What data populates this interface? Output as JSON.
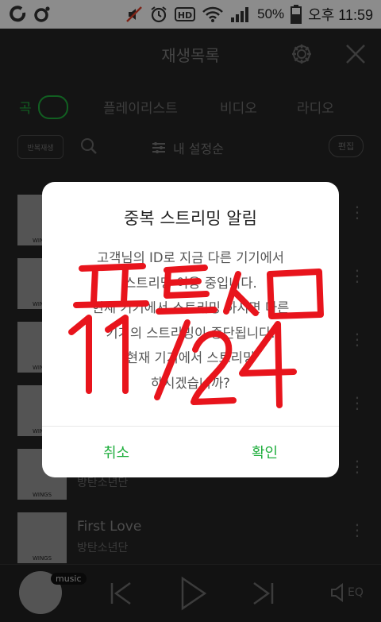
{
  "status_bar": {
    "battery": "50%",
    "time": "오후 11:59",
    "icons": [
      "o-icon",
      "record-icon",
      "mute-icon",
      "alarm-icon",
      "hd-icon",
      "wifi-icon",
      "signal-icon",
      "battery-icon"
    ]
  },
  "header": {
    "title": "재생목록",
    "icons": [
      "gear-icon",
      "close-icon"
    ]
  },
  "tabs": [
    {
      "label": "곡",
      "active": true
    },
    {
      "label": "플레이리스트"
    },
    {
      "label": "비디오"
    },
    {
      "label": "라디오"
    }
  ],
  "toolbar": {
    "repeat_label": "반복재생",
    "sort_label": "내 설정순",
    "edit_label": "편집"
  },
  "songs": [
    {
      "title": "",
      "artist": ""
    },
    {
      "title": "",
      "artist": ""
    },
    {
      "title": "",
      "artist": ""
    },
    {
      "title": "",
      "artist": ""
    },
    {
      "title": "",
      "artist": "방탄소년단"
    },
    {
      "title": "First Love",
      "artist": "방탄소년단"
    }
  ],
  "album_label": "WINGS",
  "player": {
    "badge": "music",
    "eq_label": "EQ"
  },
  "dialog": {
    "title": "중복 스트리밍 알림",
    "lines": [
      "고객님의 ID로 지금 다른 기기에서",
      "스트리밍 이용 중입니다.",
      "현재 기기에서 스트리밍 하시면 다른",
      "기기의 스트리밍이 중단됩니다.",
      "현재 기기에서 스트리밍",
      "하시겠습니까?"
    ],
    "cancel_label": "취소",
    "confirm_label": "확인"
  },
  "handwriting": {
    "line1": "프트스ㅁ",
    "line2": "11/24",
    "color": "#e8141c"
  },
  "colors": {
    "accent": "#1fae3d"
  }
}
